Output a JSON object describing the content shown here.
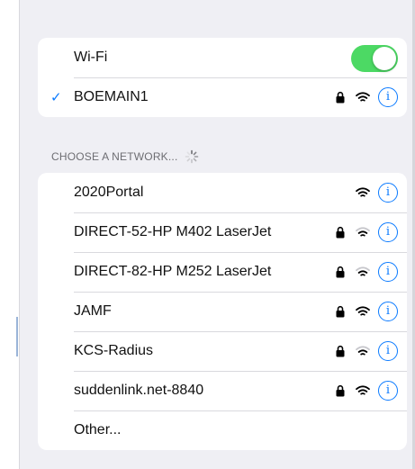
{
  "colors": {
    "accent": "#0a7aff",
    "toggle_on": "#4cd964",
    "background": "#efeff4"
  },
  "wifi": {
    "label": "Wi-Fi",
    "enabled": true
  },
  "current_network": {
    "checkmark": "✓",
    "name": "BOEMAIN1",
    "secured": true,
    "info_glyph": "i"
  },
  "section": {
    "header": "CHOOSE A NETWORK..."
  },
  "networks": [
    {
      "name": "2020Portal",
      "secured": false,
      "signal": "full"
    },
    {
      "name": "DIRECT-52-HP M402 LaserJet",
      "secured": true,
      "signal": "medium"
    },
    {
      "name": "DIRECT-82-HP M252 LaserJet",
      "secured": true,
      "signal": "medium"
    },
    {
      "name": "JAMF",
      "secured": true,
      "signal": "full"
    },
    {
      "name": "KCS-Radius",
      "secured": true,
      "signal": "medium"
    },
    {
      "name": "suddenlink.net-8840",
      "secured": true,
      "signal": "full"
    }
  ],
  "other": {
    "label": "Other..."
  },
  "icons": {
    "lock": "lock-icon",
    "wifi": "wifi-signal-icon",
    "info": "info-icon",
    "spinner": "loading-spinner-icon"
  }
}
